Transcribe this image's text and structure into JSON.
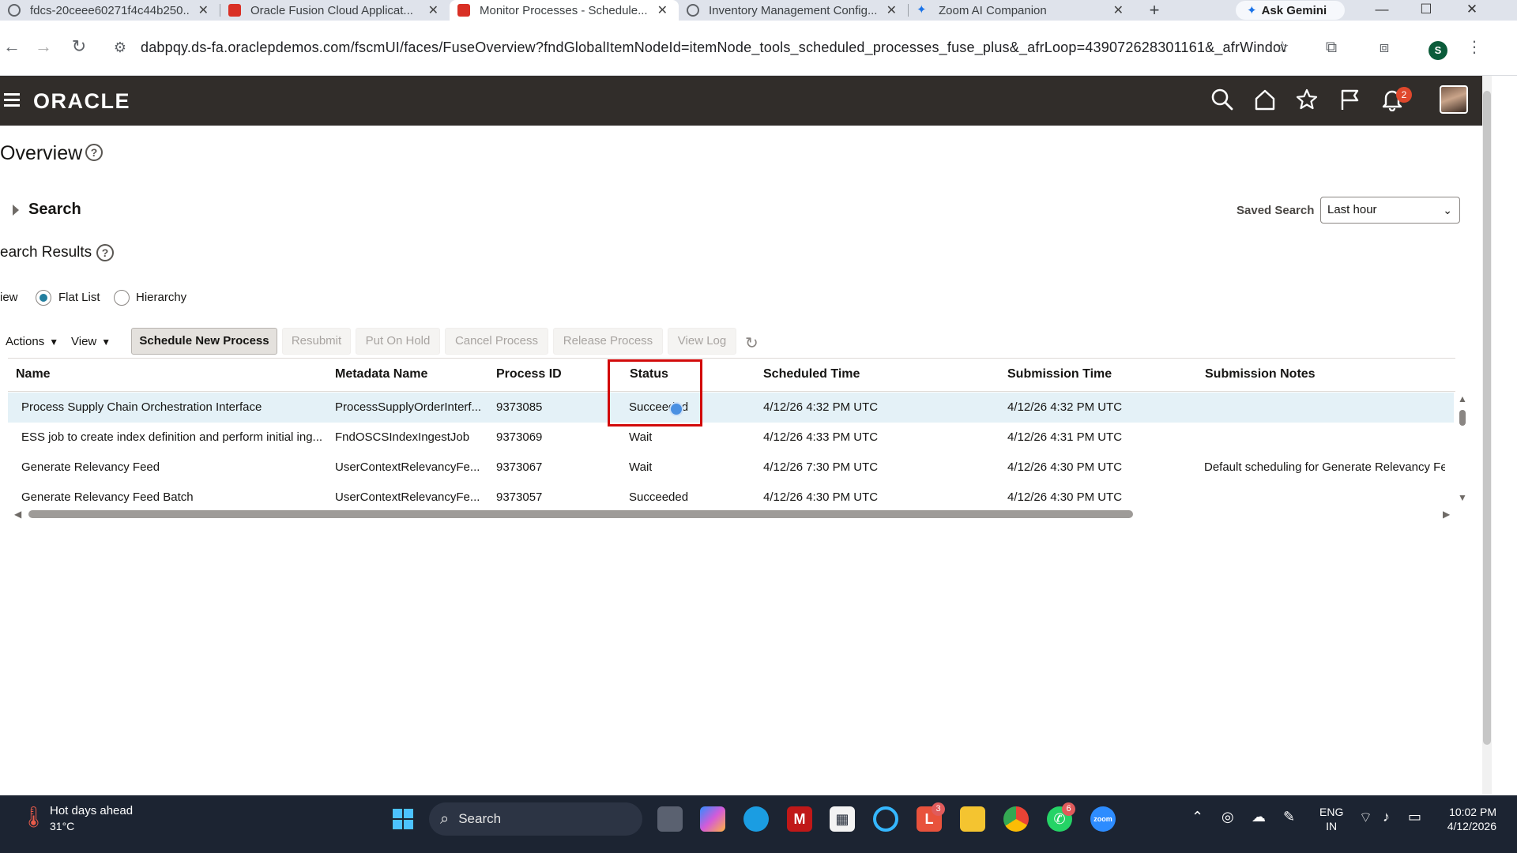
{
  "browser": {
    "tabs": [
      {
        "title": "fdcs-20ceee60271f4c44b250...",
        "favicon_color": "#5f6368"
      },
      {
        "title": "Oracle Fusion Cloud Applicat...",
        "favicon_color": "#d93025"
      },
      {
        "title": "Monitor Processes - Schedule...",
        "favicon_color": "#d93025",
        "active": true
      },
      {
        "title": "Inventory Management Config...",
        "favicon_color": "#5f6368"
      },
      {
        "title": "Zoom AI Companion",
        "favicon_color": "#1a73e8"
      }
    ],
    "new_tab": "+",
    "ask_gemini": "Ask Gemini",
    "url": "dabpqy.ds-fa.oraclepdemos.com/fscmUI/faces/FuseOverview?fndGlobalItemNodeId=itemNode_tools_scheduled_processes_fuse_plus&_afrLoop=439072628301161&_afrWindowMod...",
    "profile_initial": "S"
  },
  "header": {
    "logo": "ORACLE",
    "notification_count": "2",
    "colors": {
      "bar": "#312d2a",
      "badge": "#e0482c"
    }
  },
  "page": {
    "title": "Overview",
    "search_label": "Search",
    "saved_search_label": "Saved Search",
    "saved_search_value": "Last hour",
    "results_title": "earch Results",
    "view_label": "iew",
    "view_options": {
      "flat_list": "Flat List",
      "hierarchy": "Hierarchy",
      "selected": "Flat List"
    }
  },
  "toolbar": {
    "actions": "Actions",
    "view": "View",
    "schedule_new_process": "Schedule New Process",
    "resubmit": "Resubmit",
    "put_on_hold": "Put On Hold",
    "cancel_process": "Cancel Process",
    "release_process": "Release Process",
    "view_log": "View Log"
  },
  "table": {
    "columns": [
      "Name",
      "Metadata Name",
      "Process ID",
      "Status",
      "Scheduled Time",
      "Submission Time",
      "Submission Notes"
    ],
    "rows": [
      {
        "name": "Process Supply Chain Orchestration Interface",
        "metadata": "ProcessSupplyOrderInterf...",
        "process_id": "9373085",
        "status": "Succeeded",
        "scheduled": "4/12/26 4:32 PM UTC",
        "submitted": "4/12/26 4:32 PM UTC",
        "notes": "",
        "selected": true
      },
      {
        "name": "ESS job to create index definition and perform initial ing...",
        "metadata": "FndOSCSIndexIngestJob",
        "process_id": "9373069",
        "status": "Wait",
        "scheduled": "4/12/26 4:33 PM UTC",
        "submitted": "4/12/26 4:31 PM UTC",
        "notes": ""
      },
      {
        "name": "Generate Relevancy Feed",
        "metadata": "UserContextRelevancyFe...",
        "process_id": "9373067",
        "status": "Wait",
        "scheduled": "4/12/26 7:30 PM UTC",
        "submitted": "4/12/26 4:30 PM UTC",
        "notes": "Default scheduling for Generate Relevancy Feed"
      },
      {
        "name": "Generate Relevancy Feed Batch",
        "metadata": "UserContextRelevancyFe...",
        "process_id": "9373057",
        "status": "Succeeded",
        "scheduled": "4/12/26 4:30 PM UTC",
        "submitted": "4/12/26 4:30 PM UTC",
        "notes": ""
      }
    ]
  },
  "taskbar": {
    "weather_title": "Hot days ahead",
    "weather_temp": "31°C",
    "search_placeholder": "Search",
    "badges": {
      "app_l": "3",
      "whatsapp": "6"
    },
    "lang_line1": "ENG",
    "lang_line2": "IN",
    "time": "10:02 PM",
    "date": "4/12/2026"
  }
}
